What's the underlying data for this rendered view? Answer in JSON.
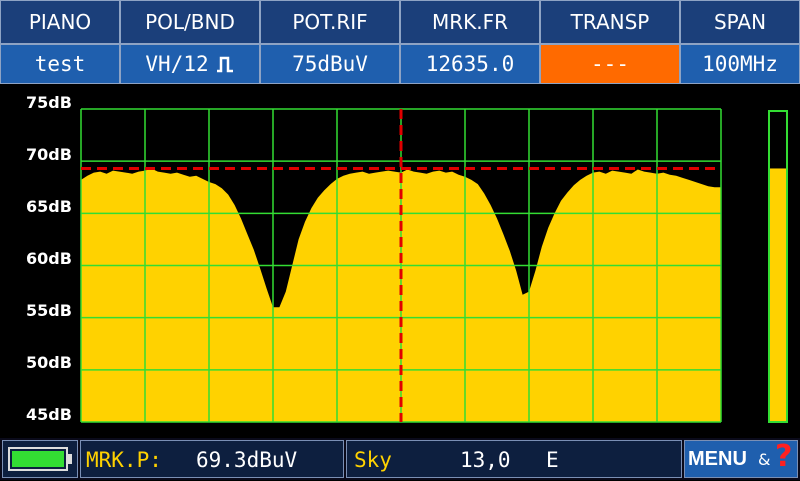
{
  "header": {
    "columns": [
      {
        "label": "PIANO",
        "value": "test"
      },
      {
        "label": "POL/BND",
        "value": "VH/12"
      },
      {
        "label": "POT.RIF",
        "value": "75dBuV"
      },
      {
        "label": "MRK.FR",
        "value": "12635.0"
      },
      {
        "label": "TRANSP",
        "value": "---"
      },
      {
        "label": "SPAN",
        "value": "100MHz"
      }
    ]
  },
  "chart_data": {
    "type": "area",
    "ylabel": "",
    "yticks": [
      "75dB",
      "70dB",
      "65dB",
      "60dB",
      "55dB",
      "50dB",
      "45dB"
    ],
    "ylim": [
      45,
      75
    ],
    "x": [
      0,
      1,
      2,
      3,
      4,
      5,
      6,
      7,
      8,
      9,
      10,
      11,
      12,
      13,
      14,
      15,
      16,
      17,
      18,
      19,
      20,
      21,
      22,
      23,
      24,
      25,
      26,
      27,
      28,
      29,
      30,
      31,
      32,
      33,
      34,
      35,
      36,
      37,
      38,
      39,
      40,
      41,
      42,
      43,
      44,
      45,
      46,
      47,
      48,
      49,
      50,
      51,
      52,
      53,
      54,
      55,
      56,
      57,
      58,
      59,
      60,
      61,
      62,
      63,
      64,
      65,
      66,
      67,
      68,
      69,
      70,
      71,
      72,
      73,
      74,
      75,
      76,
      77,
      78,
      79,
      80,
      81,
      82,
      83,
      84,
      85,
      86,
      87,
      88,
      89,
      90,
      91,
      92,
      93,
      94,
      95,
      96,
      97,
      98,
      99,
      100
    ],
    "values": [
      68.2,
      68.6,
      68.9,
      69.0,
      68.8,
      69.1,
      69.0,
      68.9,
      68.8,
      69.0,
      69.1,
      69.3,
      69.0,
      68.9,
      68.8,
      68.9,
      68.7,
      68.5,
      68.6,
      68.3,
      68.0,
      67.8,
      67.4,
      66.8,
      65.8,
      64.5,
      63.0,
      61.5,
      59.7,
      57.8,
      56.0,
      56.0,
      57.5,
      60.0,
      62.5,
      64.2,
      65.5,
      66.5,
      67.2,
      67.8,
      68.3,
      68.6,
      68.8,
      68.9,
      69.0,
      68.8,
      68.9,
      69.0,
      69.1,
      69.0,
      68.9,
      69.2,
      69.0,
      68.9,
      68.8,
      69.0,
      69.1,
      68.9,
      69.0,
      68.7,
      68.5,
      68.2,
      67.8,
      66.9,
      65.8,
      64.5,
      63.0,
      61.4,
      59.5,
      57.2,
      57.5,
      59.5,
      61.8,
      63.6,
      65.0,
      66.2,
      67.0,
      67.7,
      68.2,
      68.6,
      68.9,
      69.0,
      68.8,
      69.1,
      69.0,
      68.9,
      68.8,
      69.2,
      69.0,
      68.9,
      68.8,
      68.9,
      68.7,
      68.6,
      68.4,
      68.2,
      68.0,
      67.8,
      67.6,
      67.5,
      67.5
    ],
    "reference_level_db": 69.3,
    "marker_x": 50,
    "level_bar_db": 69.3,
    "grid": true,
    "colors": {
      "fill": "#ffd200",
      "grid": "#33dd33",
      "marker": "#e00000",
      "reference": "#e00000"
    }
  },
  "bottom": {
    "marker_label": "MRK.P:",
    "marker_value": "69.3dBuV",
    "sat_label": "Sky",
    "sat_position": "13,0",
    "sat_direction": "E",
    "menu_label": "MENU",
    "menu_amp": "&",
    "menu_help": "?",
    "battery_icon": "battery-icon"
  }
}
